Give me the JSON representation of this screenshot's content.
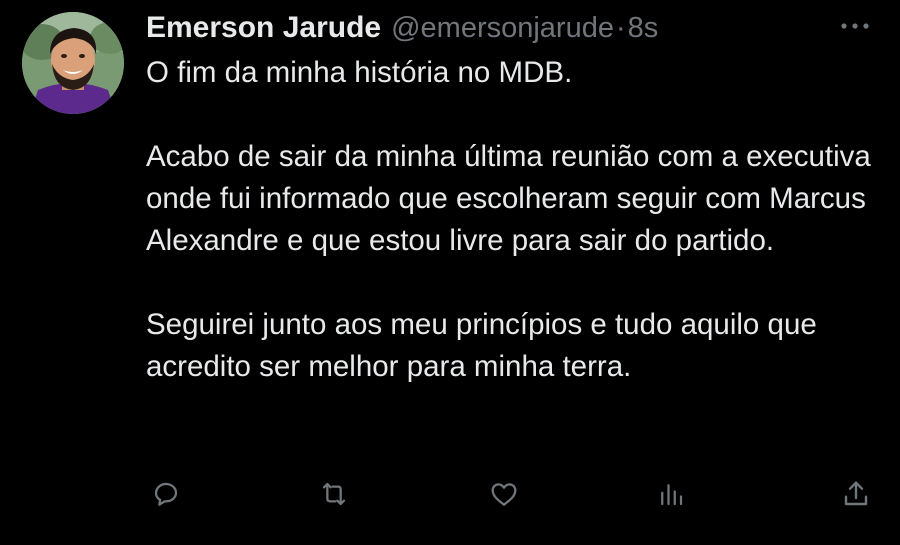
{
  "author": {
    "display_name": "Emerson Jarude",
    "handle": "@emersonjarude",
    "separator": "·",
    "time": "8s",
    "avatar_icon": "profile-photo"
  },
  "tweet": {
    "paragraph_1": "O fim da minha história no MDB.",
    "paragraph_2": "Acabo de sair da minha última reunião com a executiva onde fui informado que escolheram seguir com Marcus Alexandre e que estou livre para sair do partido.",
    "paragraph_3": "Seguirei junto aos meu princípios e tudo aquilo que acredito ser melhor para minha terra."
  },
  "actions": {
    "icons": [
      "reply-icon",
      "retweet-icon",
      "like-icon",
      "views-icon",
      "share-icon"
    ]
  },
  "colors": {
    "background": "#000000",
    "text_primary": "#e7e9ea",
    "text_secondary": "#71767b"
  }
}
